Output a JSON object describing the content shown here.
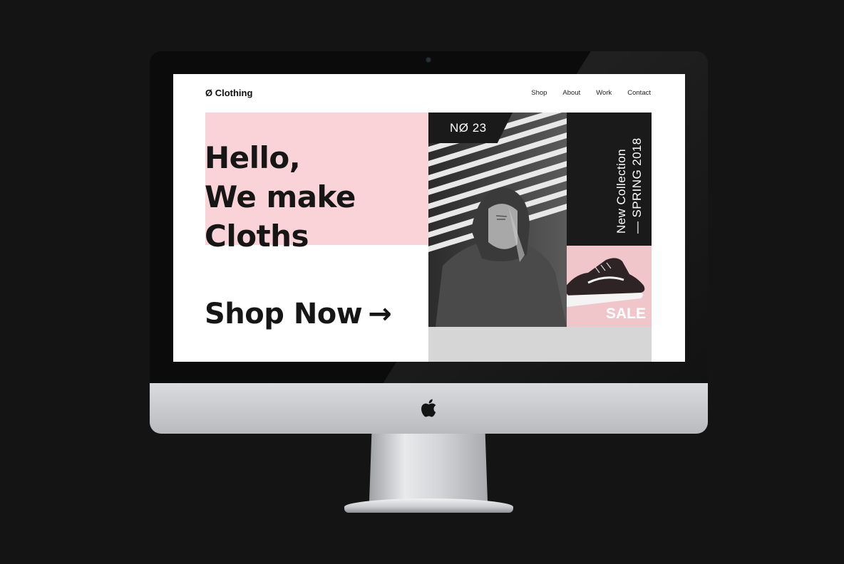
{
  "site": {
    "brand": "Ø Clothing",
    "nav": [
      "Shop",
      "About",
      "Work",
      "Contact"
    ]
  },
  "hero": {
    "headline_lines": [
      "Hello,",
      "We make",
      "Cloths"
    ],
    "cta_label": "Shop Now",
    "cta_arrow": "→"
  },
  "feature": {
    "tag": "NØ 23",
    "collection_line1": "New Collection",
    "collection_line2": "— SPRING 2018",
    "sale_label": "SALE"
  },
  "colors": {
    "accent_pink": "#f9d3d8",
    "dark": "#1a1a1a",
    "background": "#141414"
  },
  "icons": {
    "cta_arrow": "arrow-right-icon",
    "apple": "apple-logo-icon"
  }
}
